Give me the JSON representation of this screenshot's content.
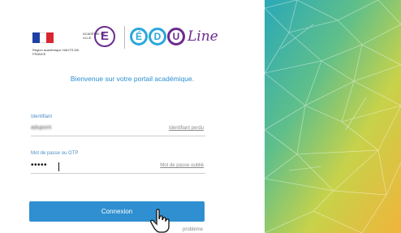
{
  "header": {
    "flag_icon": "french-flag-icon",
    "region_text": "Région académique HAUTS-DE-FRANCE",
    "academie_label": "ACADÉMIE DE LILLE",
    "academie_letter": "E",
    "edu_letters": [
      "É",
      "D",
      "U"
    ],
    "edu_suffix": "Line"
  },
  "welcome_text": "Bienvenue sur votre portail académique.",
  "login": {
    "identifier_label": "Identifiant",
    "identifier_value": "adupont",
    "identifier_forgot": "Identifiant perdu",
    "password_label": "Mot de passe ou OTP",
    "password_value": "•••••",
    "password_forgot": "Mot de passe oublié",
    "submit_label": "Connexion",
    "help_text": "problème"
  },
  "colors": {
    "accent": "#2f8fd0",
    "brand_purple": "#6a2c8f",
    "brand_blue": "#2aa7dd"
  }
}
